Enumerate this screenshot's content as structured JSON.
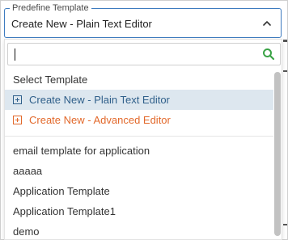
{
  "select": {
    "legend": "Predefine Template",
    "value": "Create New - Plain Text Editor"
  },
  "search": {
    "value": "",
    "placeholder": ""
  },
  "list": {
    "header": "Select Template",
    "create_basic": "Create New - Plain Text Editor",
    "create_advanced": "Create New - Advanced Editor",
    "templates": [
      "email template for application",
      "aaaaa",
      "Application Template",
      "Application Template1",
      "demo"
    ]
  },
  "colors": {
    "accent_border": "#3d7bbf",
    "search_icon": "#3aa346",
    "selected_row_bg": "#dde7ef",
    "advanced_text": "#e2682a",
    "basic_text": "#2f5f8a"
  }
}
